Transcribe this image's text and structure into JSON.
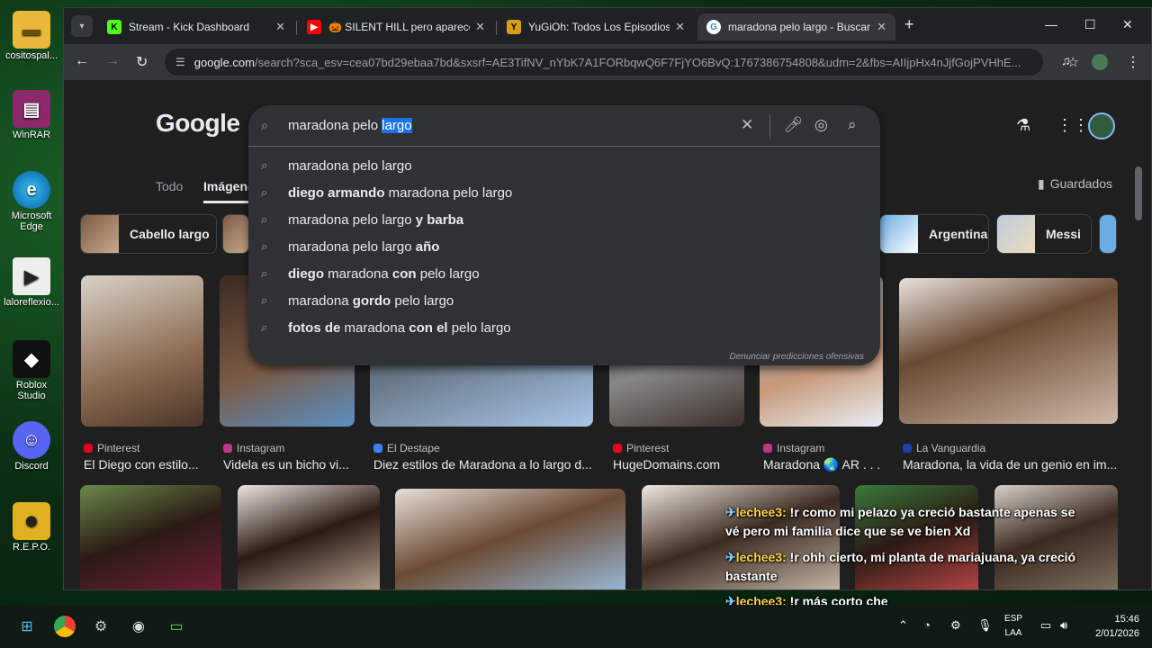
{
  "desktop": {
    "icons": [
      {
        "label": "cositospal...",
        "icon": "folder-icon"
      },
      {
        "label": "WinRAR",
        "icon": "winrar-icon"
      },
      {
        "label": "Microsoft Edge",
        "icon": "edge-icon"
      },
      {
        "label": "laloreflexio...",
        "icon": "video-file-icon"
      },
      {
        "label": "Roblox Studio",
        "icon": "roblox-icon"
      },
      {
        "label": "Discord",
        "icon": "discord-icon"
      },
      {
        "label": "R.E.P.O.",
        "icon": "repo-game-icon"
      }
    ]
  },
  "tabs": [
    {
      "title": "Stream - Kick Dashboard",
      "favicon": "kick-icon",
      "color": "#53fc18"
    },
    {
      "title": "🎃 SILENT HILL pero aparece E",
      "favicon": "youtube-icon",
      "color": "#ff0000"
    },
    {
      "title": "YuGiOh: Todos Los Episodios A",
      "favicon": "yugioh-icon",
      "color": "#d4a017"
    },
    {
      "title": "maradona pelo largo - Buscar c",
      "favicon": "google-icon",
      "color": "#4285f4",
      "active": true
    }
  ],
  "toolbar": {
    "url_host": "google.com",
    "url_rest": "/search?sca_esv=cea07bd29ebaa7bd&sxsrf=AE3TifNV_nYbK7A1FORbqwQ6F7FjYO6BvQ:1767386754808&udm=2&fbs=AIIjpHx4nJjfGojPVHhE..."
  },
  "google": {
    "logo": "Google",
    "nav_tabs": [
      "Todo",
      "Imágenes"
    ],
    "saved_label": "Guardados",
    "chips": [
      "Cabello largo",
      "Argentina",
      "Messi"
    ]
  },
  "search": {
    "query_prefix": "maradona pelo ",
    "query_selected": "largo",
    "suggestions": [
      [
        {
          "t": "maradona pelo largo",
          "b": false
        }
      ],
      [
        {
          "t": "diego armando",
          "b": true
        },
        {
          "t": " maradona pelo largo",
          "b": false
        }
      ],
      [
        {
          "t": "maradona pelo largo",
          "b": false
        },
        {
          "t": " y barba",
          "b": true
        }
      ],
      [
        {
          "t": "maradona pelo largo",
          "b": false
        },
        {
          "t": " año",
          "b": true
        }
      ],
      [
        {
          "t": "diego",
          "b": true
        },
        {
          "t": " maradona ",
          "b": false
        },
        {
          "t": "con",
          "b": true
        },
        {
          "t": " pelo largo",
          "b": false
        }
      ],
      [
        {
          "t": "maradona ",
          "b": false
        },
        {
          "t": "gordo",
          "b": true
        },
        {
          "t": " pelo largo",
          "b": false
        }
      ],
      [
        {
          "t": "fotos de",
          "b": true
        },
        {
          "t": " maradona ",
          "b": false
        },
        {
          "t": "con el",
          "b": true
        },
        {
          "t": " pelo largo",
          "b": false
        }
      ]
    ],
    "report_text": "Denunciar predicciones ofensivas"
  },
  "results": [
    {
      "source": "Pinterest",
      "caption": "El Diego con estilo...",
      "dot": "#e60023"
    },
    {
      "source": "Instagram",
      "caption": "Videla es un bicho vi...",
      "dot": "#c13584"
    },
    {
      "source": "El Destape",
      "caption": "Diez estilos de Maradona a lo largo d...",
      "dot": "#3b82f6"
    },
    {
      "source": "Pinterest",
      "caption": "HugeDomains.com",
      "dot": "#e60023"
    },
    {
      "source": "Instagram",
      "caption": "Maradona 🌏 AR . . .",
      "dot": "#c13584"
    },
    {
      "source": "La Vanguardia",
      "caption": "Maradona, la vida de un genio en im...",
      "dot": "#1e40af"
    }
  ],
  "chat": [
    {
      "user": "lechee3:",
      "text": " !r como mi pelazo ya creció bastante apenas se"
    },
    {
      "user": "",
      "text": "vé pero mi familia dice que se ve bien Xd"
    },
    {
      "user": "lechee3:",
      "text": " !r ohh cierto, mi planta de mariajuana, ya creció"
    },
    {
      "user": "",
      "text": "bastante"
    },
    {
      "user": "lechee3:",
      "text": " !r más corto che"
    }
  ],
  "taskbar": {
    "lang_top": "ESP",
    "lang_bottom": "LAA",
    "time": "15:46",
    "date": "2/01/2026"
  }
}
